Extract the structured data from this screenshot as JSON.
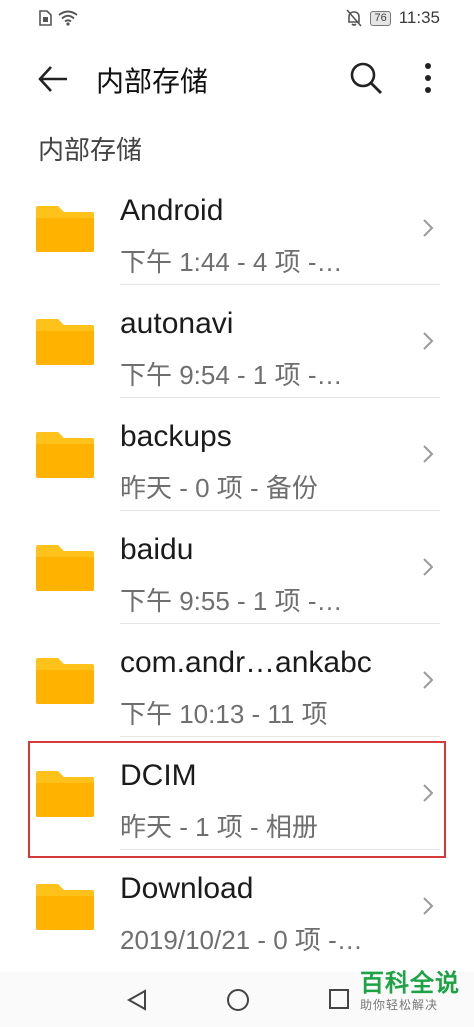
{
  "status_bar": {
    "battery": "76",
    "time": "11:35"
  },
  "header": {
    "title": "内部存储",
    "icons": {
      "back": "arrow-left-icon",
      "search": "search-icon",
      "more": "more-vert-icon"
    }
  },
  "breadcrumb": "内部存储",
  "folders": [
    {
      "name": "Android",
      "meta": "下午 1:44  - 4 项 -…"
    },
    {
      "name": "autonavi",
      "meta": "下午 9:54  - 1 项 -…"
    },
    {
      "name": "backups",
      "meta": "昨天 - 0 项 - 备份"
    },
    {
      "name": "baidu",
      "meta": "下午 9:55  - 1 项 -…"
    },
    {
      "name": "com.andr…ankabc",
      "meta": "下午 10:13  - 11 项"
    },
    {
      "name": "DCIM",
      "meta": "昨天 - 1 项 - 相册"
    },
    {
      "name": "Download",
      "meta": "2019/10/21 - 0 项 -…"
    }
  ],
  "colors": {
    "folder": "#ffc21a",
    "folder_tab": "#ffd54f",
    "highlight": "#d53a3a",
    "watermark": "#1da345"
  },
  "watermark": {
    "title": "百科全说",
    "subtitle": "助你轻松解决"
  }
}
